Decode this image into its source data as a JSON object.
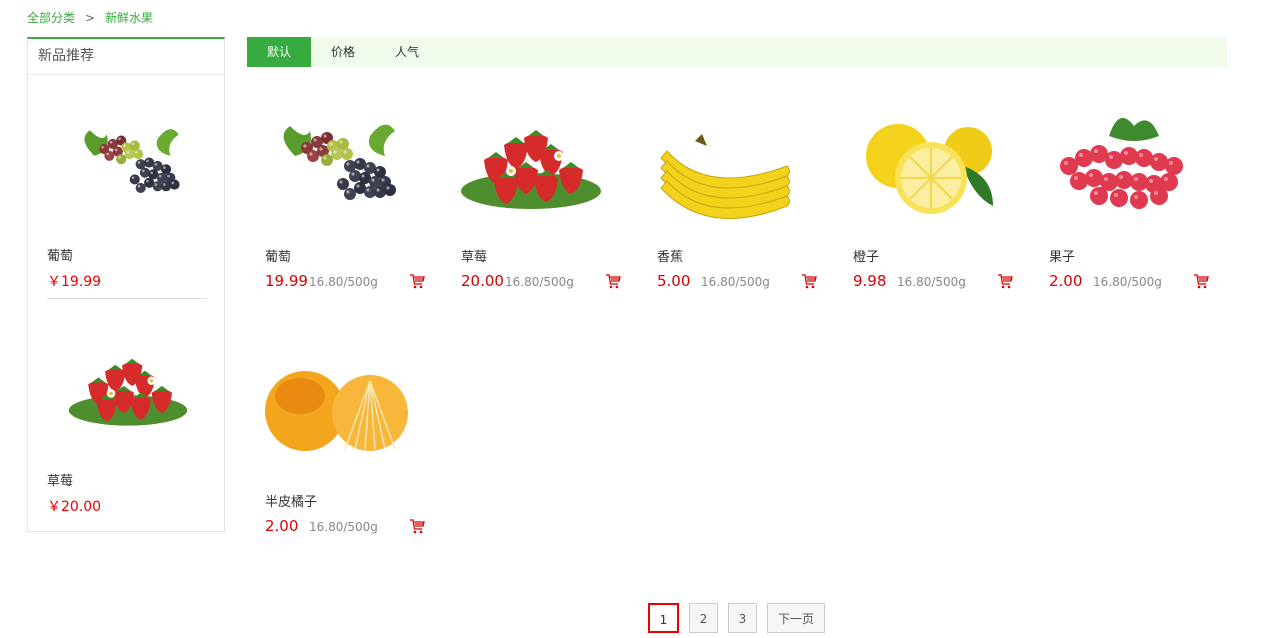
{
  "breadcrumb": {
    "root": "全部分类",
    "separator": ">",
    "current": "新鲜水果"
  },
  "sidebar": {
    "title": "新品推荐",
    "items": [
      {
        "name": "葡萄",
        "price": "￥19.99",
        "image": "grapes"
      },
      {
        "name": "草莓",
        "price": "￥20.00",
        "image": "strawberries"
      }
    ]
  },
  "sort_tabs": [
    "默认",
    "价格",
    "人气"
  ],
  "products": [
    {
      "name": "葡萄",
      "price": "19.99",
      "unit_price": "16.80/500g",
      "image": "grapes"
    },
    {
      "name": "草莓",
      "price": "20.00",
      "unit_price": "16.80/500g",
      "image": "strawberries"
    },
    {
      "name": "香蕉",
      "price": "5.00",
      "unit_price": "16.80/500g",
      "image": "bananas"
    },
    {
      "name": "橙子",
      "price": "9.98",
      "unit_price": "16.80/500g",
      "image": "lemons"
    },
    {
      "name": "果子",
      "price": "2.00",
      "unit_price": "16.80/500g",
      "image": "raspberries"
    },
    {
      "name": "半皮橘子",
      "price": "2.00",
      "unit_price": "16.80/500g",
      "image": "tangerines"
    }
  ],
  "pagination": {
    "pages": [
      "1",
      "2",
      "3"
    ],
    "current": "1",
    "next_label": "下一页"
  },
  "colors": {
    "accent": "#37ab40",
    "price": "#d80000",
    "sortbar_bg": "#f0fbeb"
  },
  "icons": [
    "cart-icon"
  ]
}
